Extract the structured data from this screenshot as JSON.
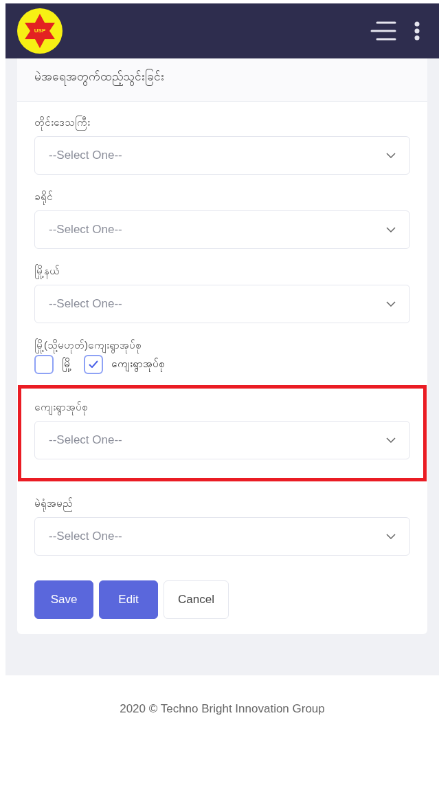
{
  "header": {
    "logo_text": "USP"
  },
  "form": {
    "title": "မဲအရေအတွက်ထည့်သွင်းခြင်း",
    "fields": [
      {
        "kind": "select",
        "label": "တိုင်းဒေသကြီး",
        "placeholder": "--Select One--",
        "highlighted": false
      },
      {
        "kind": "select",
        "label": "ခရိုင်",
        "placeholder": "--Select One--",
        "highlighted": false
      },
      {
        "kind": "select",
        "label": "မြို့နယ်",
        "placeholder": "--Select One--",
        "highlighted": false
      },
      {
        "kind": "checkboxes",
        "label": "မြို့(သို့မဟုတ်)ကျေးရွာအုပ်စု",
        "options": [
          {
            "label": "မြို့",
            "checked": false
          },
          {
            "label": "ကျေးရွာအုပ်စု",
            "checked": true
          }
        ]
      },
      {
        "kind": "select",
        "label": "ကျေးရွာအုပ်စု",
        "placeholder": "--Select One--",
        "highlighted": true
      },
      {
        "kind": "select",
        "label": "မဲရုံအမည်",
        "placeholder": "--Select One--",
        "highlighted": false
      }
    ],
    "buttons": [
      {
        "label": "Save",
        "kind": "primary"
      },
      {
        "label": "Edit",
        "kind": "primary"
      },
      {
        "label": "Cancel",
        "kind": "plain"
      }
    ]
  },
  "footer": "2020 © Techno Bright Innovation Group"
}
